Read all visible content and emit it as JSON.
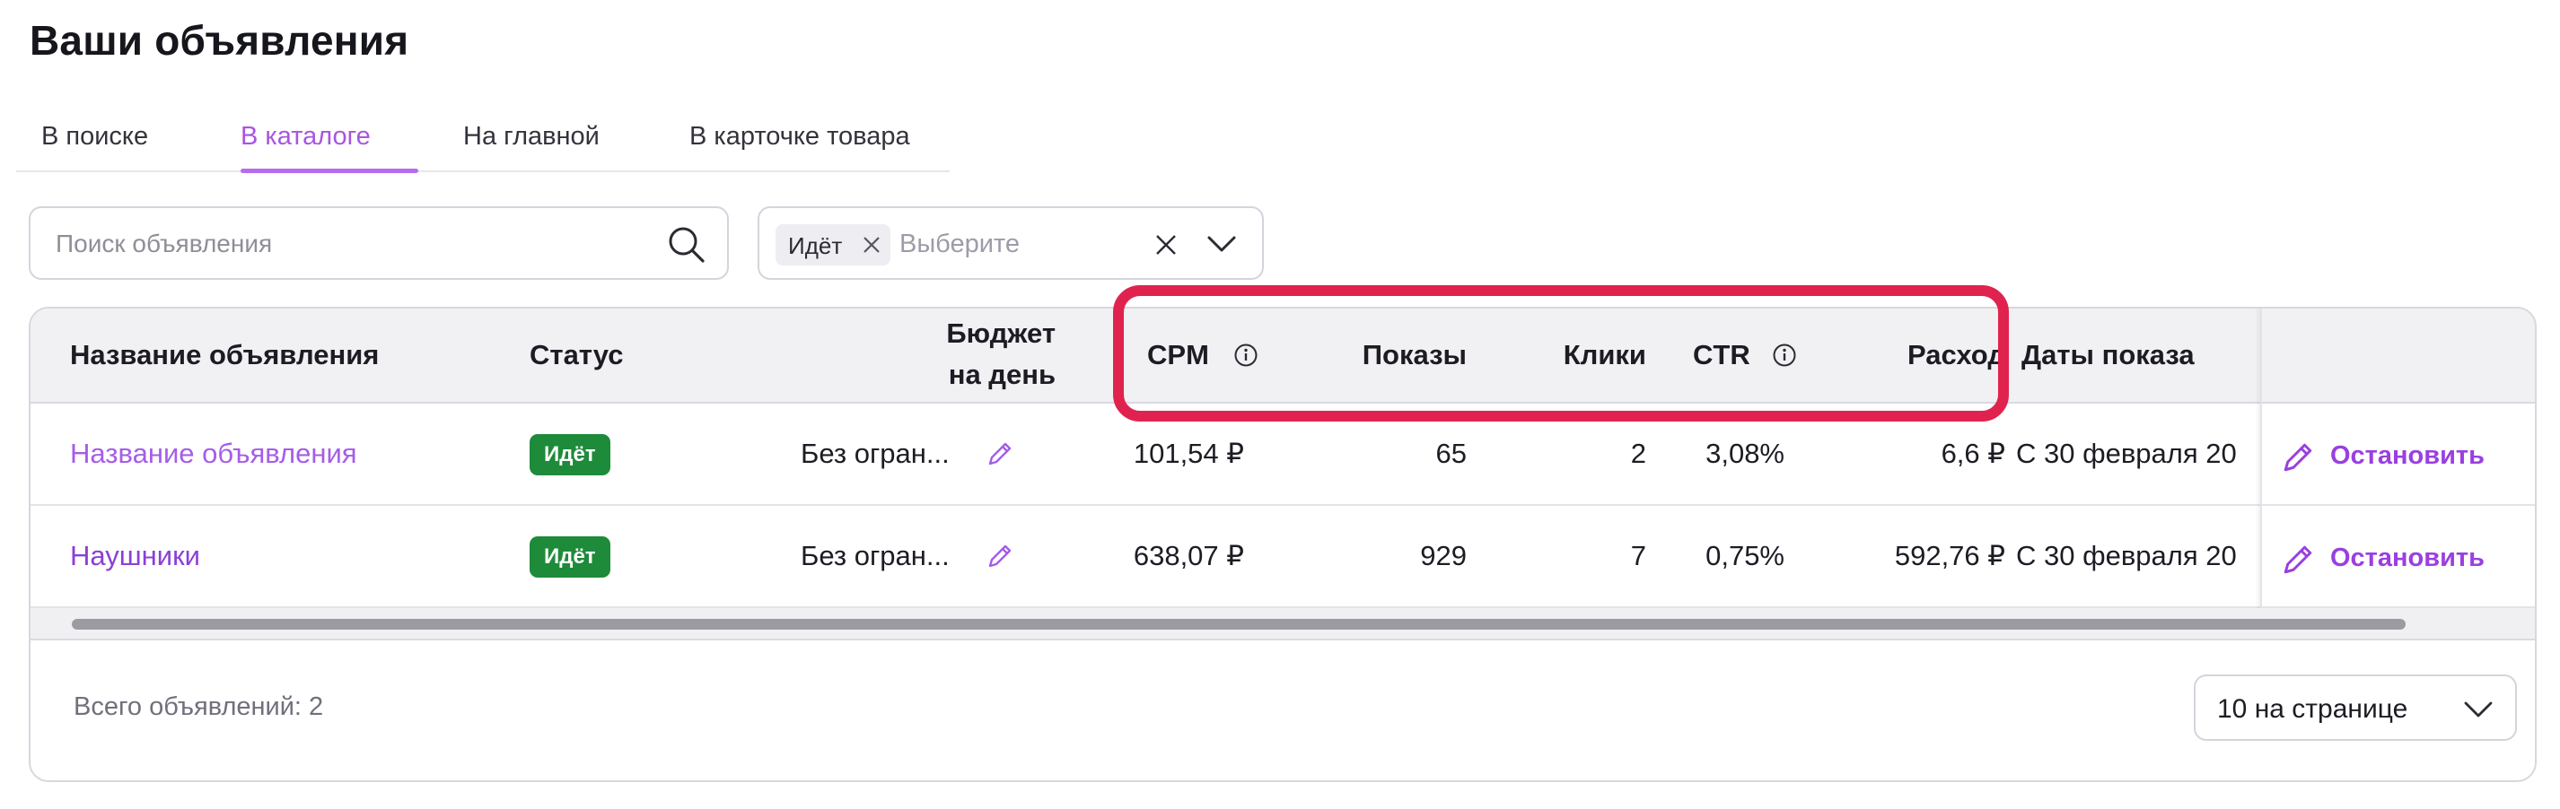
{
  "page": {
    "title": "Ваши объявления"
  },
  "tabs": [
    {
      "label": "В поиске",
      "active": false
    },
    {
      "label": "В каталоге",
      "active": true
    },
    {
      "label": "На главной",
      "active": false
    },
    {
      "label": "В карточке товара",
      "active": false
    }
  ],
  "search": {
    "placeholder": "Поиск объявления",
    "icon": "search-icon"
  },
  "status_filter": {
    "selected_chip": "Идёт",
    "placeholder": "Выберите"
  },
  "table": {
    "columns": {
      "name": "Название объявления",
      "status": "Статус",
      "budget_line1": "Бюджет",
      "budget_line2": "на день",
      "cpm": "CPM",
      "impressions": "Показы",
      "clicks": "Клики",
      "ctr": "CTR",
      "spend": "Расход",
      "dates": "Даты показа"
    },
    "rows": [
      {
        "name": "Название объявления",
        "status": "Идёт",
        "budget": "Без огран...",
        "cpm": "101,54 ₽",
        "impressions": "65",
        "clicks": "2",
        "ctr": "3,08%",
        "spend": "6,6 ₽",
        "dates": "С 30 февраля 20",
        "action": "Остановить"
      },
      {
        "name": "Наушники",
        "status": "Идёт",
        "budget": "Без огран...",
        "cpm": "638,07 ₽",
        "impressions": "929",
        "clicks": "7",
        "ctr": "0,75%",
        "spend": "592,76 ₽",
        "dates": "С 30 февраля 20",
        "action": "Остановить"
      }
    ]
  },
  "footer": {
    "total": "Всего объявлений: 2",
    "per_page": "10 на странице"
  },
  "colors": {
    "accent": "#a855e0",
    "status_active": "#1e8b3a",
    "highlight": "#e0234e"
  }
}
